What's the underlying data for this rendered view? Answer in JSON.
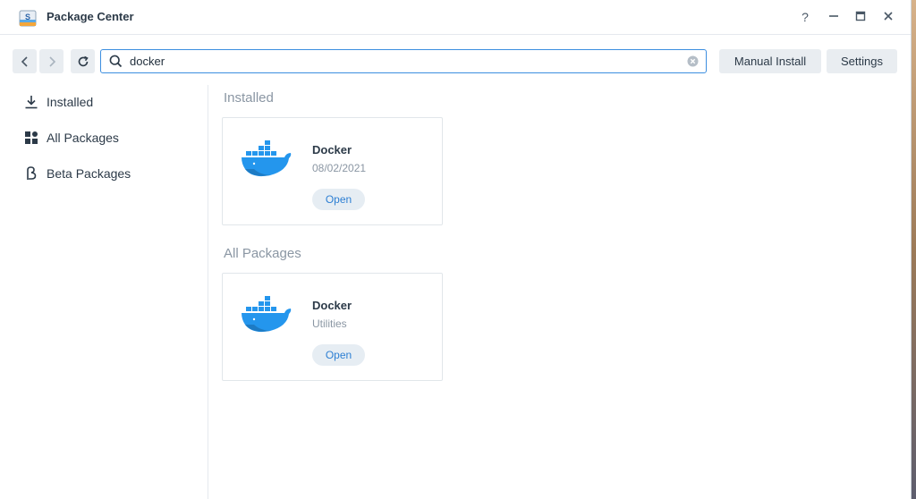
{
  "window": {
    "title": "Package Center"
  },
  "window_controls": {
    "help": "?",
    "minimize": "—",
    "maximize": "▣",
    "close": "✕"
  },
  "toolbar": {
    "search_value": "docker",
    "manual_install_label": "Manual Install",
    "settings_label": "Settings"
  },
  "sidebar": {
    "items": [
      {
        "label": "Installed",
        "icon": "download-icon"
      },
      {
        "label": "All Packages",
        "icon": "grid-icon"
      },
      {
        "label": "Beta Packages",
        "icon": "beta-icon"
      }
    ]
  },
  "sections": [
    {
      "title": "Installed",
      "cards": [
        {
          "name": "Docker",
          "subtitle": "08/02/2021",
          "action": "Open",
          "icon": "docker-whale-icon"
        }
      ]
    },
    {
      "title": "All Packages",
      "cards": [
        {
          "name": "Docker",
          "subtitle": "Utilities",
          "action": "Open",
          "icon": "docker-whale-icon"
        }
      ]
    }
  ],
  "colors": {
    "accent": "#3c8ee0",
    "docker_blue": "#2496ed",
    "open_text": "#2d7fd3"
  }
}
